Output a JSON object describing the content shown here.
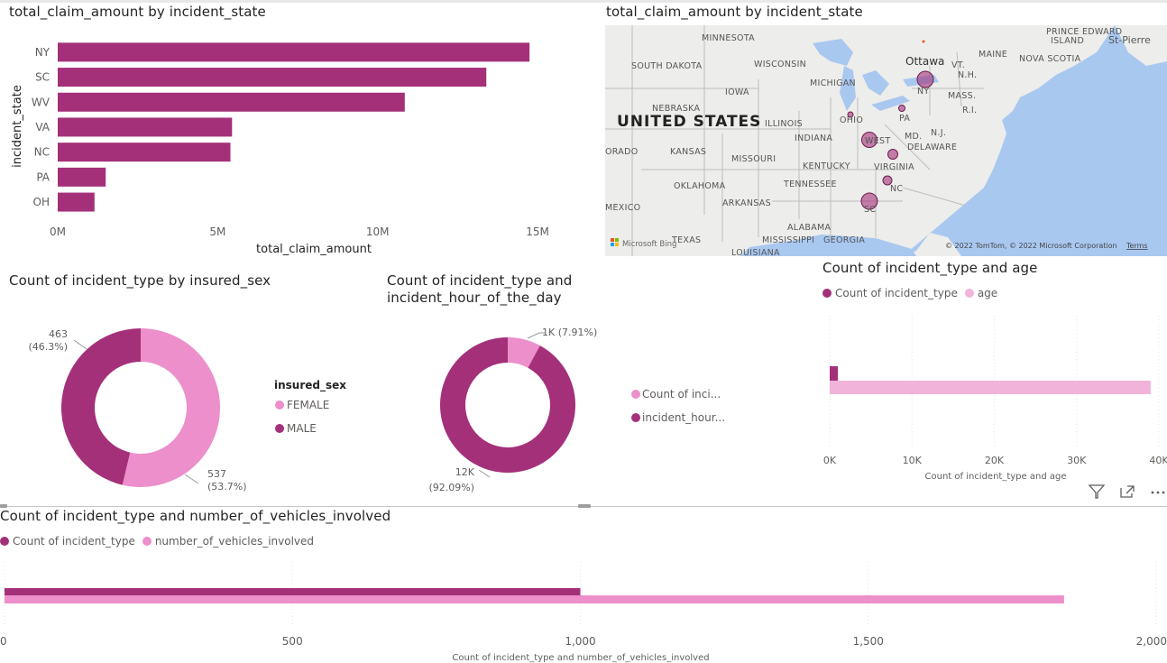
{
  "colors": {
    "dark": "#A4307A",
    "light": "#EC8FCB",
    "lighter": "#F2B3DA",
    "water": "#A9C8F0",
    "land": "#EDEDEB"
  },
  "bar_state": {
    "title": "total_claim_amount by incident_state",
    "xlabel": "total_claim_amount",
    "ylabel": "incident_state",
    "tick_labels": [
      "0M",
      "5M",
      "10M",
      "15M"
    ]
  },
  "map_state": {
    "title": "total_claim_amount by incident_state",
    "country_label": "UNITED STATES",
    "place_labels": [
      "MINNESOTA",
      "SOUTH DAKOTA",
      "WISCONSIN",
      "MICHIGAN",
      "IOWA",
      "NEBRASKA",
      "ILLINOIS",
      "OHIO",
      "INDIANA",
      "KANSAS",
      "MISSOURI",
      "KENTUCKY",
      "VIRGINIA",
      "WEST",
      "OKLAHOMA",
      "TENNESSEE",
      "ARKANSAS",
      "TEXAS",
      "MISSISSIPPI",
      "ALABAMA",
      "GEORGIA",
      "LOUISIANA",
      "Ottawa",
      "MAINE",
      "NOVA SCOTIA",
      "St-Pierre",
      "VT.",
      "N.H.",
      "MASS.",
      "R.I.",
      "N.J.",
      "MD.",
      "DELAWARE",
      "PRINCE EDWARD",
      "ISLAND",
      "ORADO",
      "MEXICO",
      "NY",
      "PA",
      "NC",
      "SC"
    ],
    "bing_label": "Microsoft Bing",
    "copyright": "© 2022 TomTom, © 2022 Microsoft Corporation",
    "terms": "Terms"
  },
  "donut_sex": {
    "title": "Count of incident_type by insured_sex",
    "legend_title": "insured_sex",
    "legend_items": [
      "FEMALE",
      "MALE"
    ],
    "label_male_value": "463",
    "label_male_pct": "(46.3%)",
    "label_female_value": "537",
    "label_female_pct": "(53.7%)"
  },
  "donut_hour": {
    "title": "Count of incident_type and incident_hour_of_the_day",
    "legend_items": [
      "Count of inci...",
      "incident_hour..."
    ],
    "label_small": "1K (7.91%)",
    "label_large_value": "12K",
    "label_large_pct": "(92.09%)"
  },
  "bar_age": {
    "title": "Count of incident_type and age",
    "legend_items": [
      "Count of incident_type",
      "age"
    ],
    "tick_labels": [
      "0K",
      "10K",
      "20K",
      "30K",
      "40K"
    ],
    "xlabel": "Count of incident_type and age"
  },
  "bar_vehicles": {
    "title": "Count of incident_type and number_of_vehicles_involved",
    "legend_items": [
      "Count of incident_type",
      "number_of_vehicles_involved"
    ],
    "tick_labels": [
      "0",
      "500",
      "1,000",
      "1,500",
      "2,000"
    ],
    "xlabel": "Count of incident_type and number_of_vehicles_involved"
  },
  "chart_data": [
    {
      "type": "bar",
      "orientation": "horizontal",
      "title": "total_claim_amount by incident_state",
      "categories": [
        "NY",
        "SC",
        "WV",
        "VA",
        "NC",
        "PA",
        "OH"
      ],
      "values": [
        14750000,
        13400000,
        10850000,
        5450000,
        5400000,
        1500000,
        1150000
      ],
      "xlabel": "total_claim_amount",
      "ylabel": "incident_state",
      "xlim": [
        0,
        15000000
      ],
      "grid": false
    },
    {
      "type": "pie",
      "donut": true,
      "title": "Count of incident_type by insured_sex",
      "categories": [
        "FEMALE",
        "MALE"
      ],
      "values": [
        537,
        463
      ],
      "legend_title": "insured_sex",
      "legend": "right"
    },
    {
      "type": "pie",
      "donut": true,
      "title": "Count of incident_type and incident_hour_of_the_day",
      "categories": [
        "Count of incident_type",
        "incident_hour_of_the_day"
      ],
      "values": [
        1000,
        11639
      ],
      "percents": [
        7.91,
        92.09
      ],
      "legend": "right"
    },
    {
      "type": "bar",
      "orientation": "horizontal",
      "title": "Count of incident_type and age",
      "series": [
        {
          "name": "Count of incident_type",
          "values": [
            1000
          ]
        },
        {
          "name": "age",
          "values": [
            39000
          ]
        }
      ],
      "xlim": [
        0,
        40000
      ],
      "xlabel": "Count of incident_type and age",
      "legend": "top-left"
    },
    {
      "type": "bar",
      "orientation": "horizontal",
      "title": "Count of incident_type and number_of_vehicles_involved",
      "series": [
        {
          "name": "Count of incident_type",
          "values": [
            1000
          ]
        },
        {
          "name": "number_of_vehicles_involved",
          "values": [
            1840
          ]
        }
      ],
      "xlim": [
        0,
        2000
      ],
      "xlabel": "Count of incident_type and number_of_vehicles_involved",
      "legend": "top-left"
    }
  ]
}
